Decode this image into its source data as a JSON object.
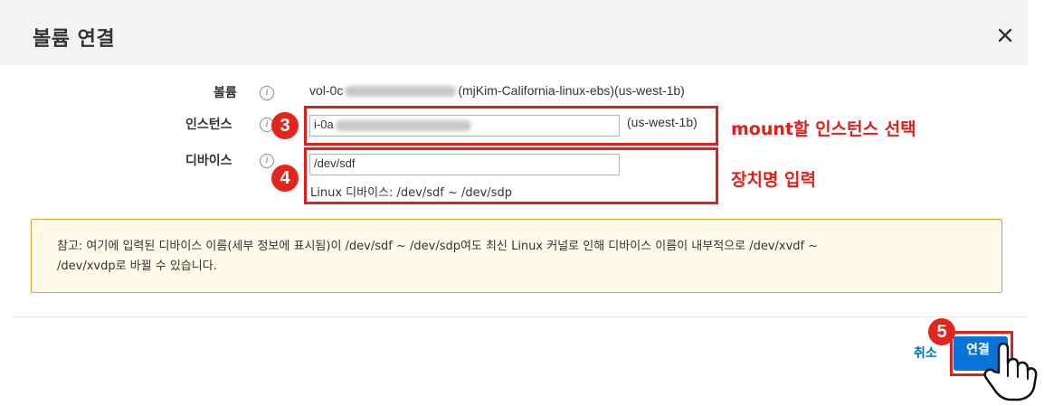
{
  "dialog": {
    "title": "볼륨 연결",
    "close_icon": "close-icon"
  },
  "form": {
    "volume": {
      "label": "볼륨",
      "value_prefix": "vol-0c",
      "value_suffix": "(mjKim-California-linux-ebs)(us-west-1b)"
    },
    "instance": {
      "label": "인스턴스",
      "value": "i-0a",
      "region": "(us-west-1b)"
    },
    "device": {
      "label": "디바이스",
      "value": "/dev/sdf",
      "hint": "Linux 디바이스: /dev/sdf ~ /dev/sdp"
    }
  },
  "annotations": {
    "step3": "3",
    "step4": "4",
    "step5": "5",
    "instance_note": "mount할 인스턴스 선택",
    "device_note": "장치명 입력"
  },
  "note": {
    "line1": "참고: 여기에 입력된 디바이스 이름(세부 정보에 표시됨)이 /dev/sdf ~ /dev/sdp여도 최신 Linux 커널로 인해 디바이스 이름이 내부적으로 /dev/xvdf ~",
    "line2": "/dev/xvdp로 바뀔 수 있습니다."
  },
  "footer": {
    "cancel_label": "취소",
    "attach_label": "연결"
  },
  "colors": {
    "accent": "#0a73d8",
    "annotation_red": "#e0201b",
    "note_border": "#eb9d3c",
    "note_bg": "#fffbeb"
  }
}
